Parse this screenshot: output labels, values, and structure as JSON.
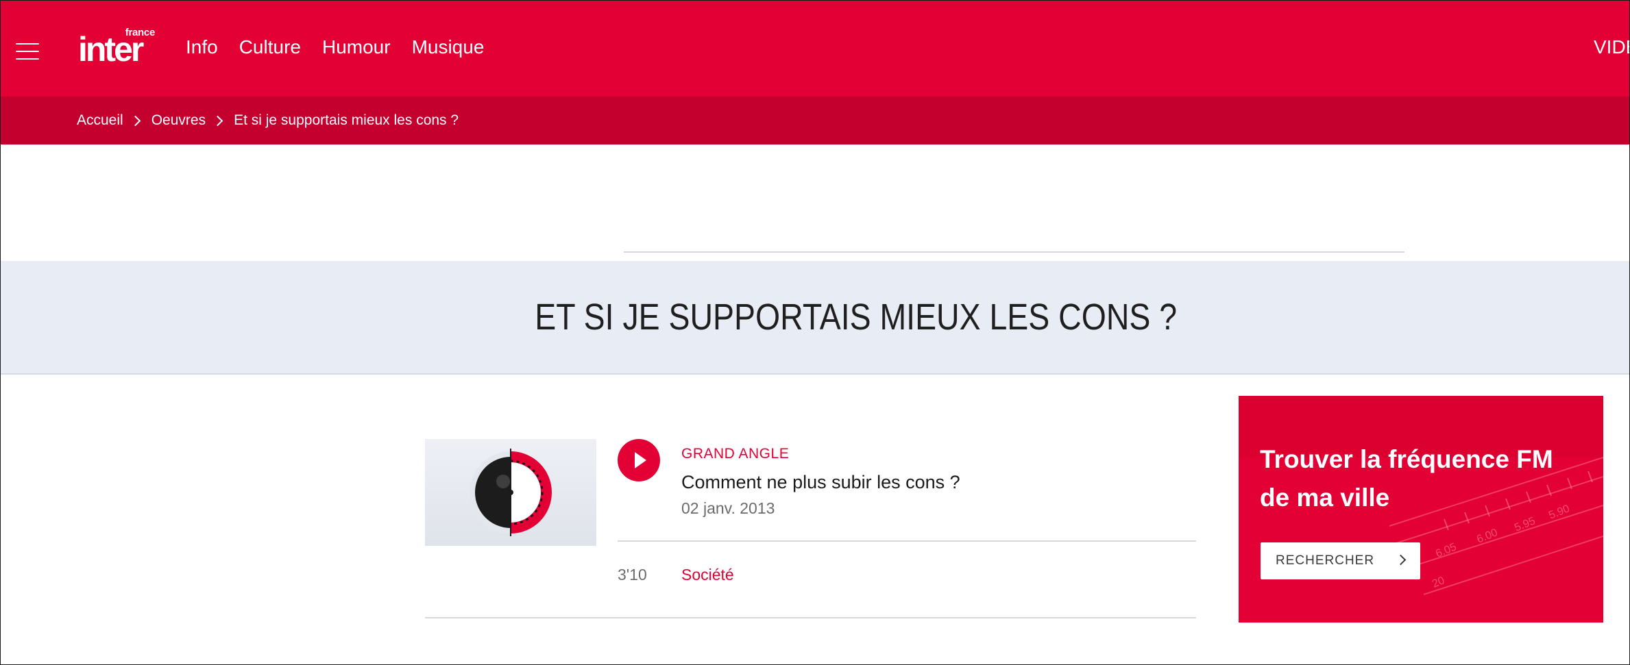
{
  "header": {
    "logo_small": "france",
    "logo_big": "inter",
    "nav": [
      "Info",
      "Culture",
      "Humour",
      "Musique"
    ],
    "nav_right": "VIDE"
  },
  "breadcrumb": [
    "Accueil",
    "Oeuvres",
    "Et si je supportais mieux les cons ?"
  ],
  "page_title": "ET SI JE SUPPORTAIS MIEUX LES CONS ?",
  "episode": {
    "kicker": "GRAND ANGLE",
    "title": "Comment ne plus subir les cons ?",
    "date": "02 janv. 2013",
    "duration": "3'10",
    "tag": "Société"
  },
  "promo": {
    "title": "Trouver la fréquence FM de ma ville",
    "button": "RECHERCHER"
  },
  "colors": {
    "brand": "#e20034",
    "brand_dark": "#c3002e",
    "band": "#e8edf5"
  }
}
